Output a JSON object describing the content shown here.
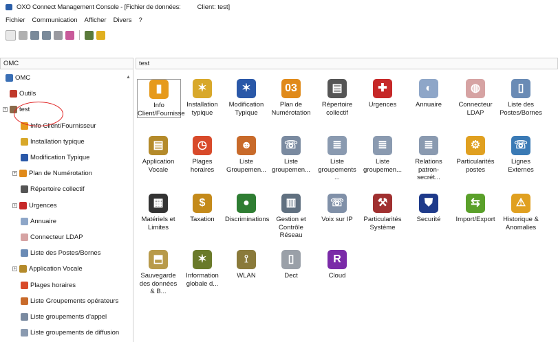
{
  "window": {
    "title": "OXO Connect Management Console - [Fichier de données:",
    "client": "Client: test]"
  },
  "menu": [
    "Fichier",
    "Communication",
    "Afficher",
    "Divers",
    "?"
  ],
  "toolbar_icons": [
    "new-icon",
    "open-icon",
    "save-icon",
    "save-as-icon",
    "print-icon",
    "connect-icon",
    "disk-icon",
    "help-icon"
  ],
  "panels": {
    "left_title": "OMC",
    "right_title": "test"
  },
  "tree": [
    {
      "label": "OMC",
      "icon": "omc-icon",
      "color": "#3a6fb5"
    },
    {
      "label": "Outils",
      "icon": "tools-icon",
      "color": "#c0392b"
    },
    {
      "label": "test",
      "icon": "folder-icon",
      "color": "#8a6a4a"
    },
    {
      "label": "Info Client/Fournisseur",
      "icon": "info-icon",
      "color": "#e69a1c"
    },
    {
      "label": "Installation typique",
      "icon": "installation-icon",
      "color": "#d8a82a"
    },
    {
      "label": "Modification Typique",
      "icon": "modification-icon",
      "color": "#2a58a8"
    },
    {
      "label": "Plan de Numérotation",
      "icon": "numbering-icon",
      "color": "#e08a1a"
    },
    {
      "label": "Répertoire collectif",
      "icon": "directory-icon",
      "color": "#555555"
    },
    {
      "label": "Urgences",
      "icon": "emergency-icon",
      "color": "#c62828"
    },
    {
      "label": "Annuaire",
      "icon": "annuaire-icon",
      "color": "#8ea6c8"
    },
    {
      "label": "Connecteur LDAP",
      "icon": "ldap-icon",
      "color": "#d6a3a3"
    },
    {
      "label": "Liste des Postes/Bornes",
      "icon": "postes-icon",
      "color": "#6a8bb5"
    },
    {
      "label": "Application Vocale",
      "icon": "voice-app-icon",
      "color": "#b48a2a"
    },
    {
      "label": "Plages horaires",
      "icon": "clock-icon",
      "color": "#d84a2a"
    },
    {
      "label": "Liste Groupements opérateurs",
      "icon": "operator-groups-icon",
      "color": "#c86a2a"
    },
    {
      "label": "Liste groupements d'appel",
      "icon": "call-groups-icon",
      "color": "#7a8aa0"
    },
    {
      "label": "Liste groupements de diffusion",
      "icon": "broadcast-groups-icon",
      "color": "#8a9ab0"
    }
  ],
  "grid": [
    {
      "label": "Info Client/Fournisse",
      "icon": "info-icon",
      "color": "#e69a1c",
      "glyph": "▮"
    },
    {
      "label": "Installation typique",
      "icon": "installation-icon",
      "color": "#d8a82a",
      "glyph": "✶"
    },
    {
      "label": "Modification Typique",
      "icon": "modification-icon",
      "color": "#2a58a8",
      "glyph": "✶"
    },
    {
      "label": "Plan de Numérotation",
      "icon": "numbering-icon",
      "color": "#e08a1a",
      "glyph": "03"
    },
    {
      "label": "Répertoire collectif",
      "icon": "directory-icon",
      "color": "#555555",
      "glyph": "▤"
    },
    {
      "label": "Urgences",
      "icon": "emergency-icon",
      "color": "#c62828",
      "glyph": "✚"
    },
    {
      "label": "Annuaire",
      "icon": "annuaire-icon",
      "color": "#8ea6c8",
      "glyph": "◐"
    },
    {
      "label": "Connecteur LDAP",
      "icon": "ldap-icon",
      "color": "#d6a3a3",
      "glyph": "◍"
    },
    {
      "label": "Liste des Postes/Bornes",
      "icon": "postes-icon",
      "color": "#6a8bb5",
      "glyph": "▯"
    },
    {
      "label": "Application Vocale",
      "icon": "voice-app-icon",
      "color": "#b48a2a",
      "glyph": "▤"
    },
    {
      "label": "Plages horaires",
      "icon": "clock-icon",
      "color": "#d84a2a",
      "glyph": "◷"
    },
    {
      "label": "Liste Groupemen...",
      "icon": "operator-groups-icon",
      "color": "#c86a2a",
      "glyph": "☻"
    },
    {
      "label": "Liste groupemen...",
      "icon": "call-groups-icon",
      "color": "#7a8aa0",
      "glyph": "☏"
    },
    {
      "label": "Liste groupements ...",
      "icon": "broadcast-groups-icon",
      "color": "#8a9ab0",
      "glyph": "≣"
    },
    {
      "label": "Liste groupemen...",
      "icon": "groups-list-icon",
      "color": "#8a9ab0",
      "glyph": "≣"
    },
    {
      "label": "Relations patron-secrét...",
      "icon": "boss-secretary-icon",
      "color": "#8a9ab0",
      "glyph": "≣"
    },
    {
      "label": "Particularités postes",
      "icon": "station-features-icon",
      "color": "#e0a020",
      "glyph": "⚙"
    },
    {
      "label": "Lignes Externes",
      "icon": "external-lines-icon",
      "color": "#3a7ab5",
      "glyph": "☏"
    },
    {
      "label": "Matériels et Limites",
      "icon": "hardware-icon",
      "color": "#333333",
      "glyph": "▦"
    },
    {
      "label": "Taxation",
      "icon": "taxation-icon",
      "color": "#c48a1a",
      "glyph": "$"
    },
    {
      "label": "Discriminations",
      "icon": "discrimination-icon",
      "color": "#2e7d32",
      "glyph": "●"
    },
    {
      "label": "Gestion et Contrôle Réseau",
      "icon": "network-icon",
      "color": "#607080",
      "glyph": "▥"
    },
    {
      "label": "Voix sur IP",
      "icon": "voip-icon",
      "color": "#8090a8",
      "glyph": "☏"
    },
    {
      "label": "Particularités Système",
      "icon": "system-features-icon",
      "color": "#a03030",
      "glyph": "⚒"
    },
    {
      "label": "Securité",
      "icon": "security-icon",
      "color": "#1e3a8a",
      "glyph": "⛊"
    },
    {
      "label": "Import/Export",
      "icon": "import-export-icon",
      "color": "#5aa02a",
      "glyph": "⇆"
    },
    {
      "label": "Historique & Anomalies",
      "icon": "history-icon",
      "color": "#e0a020",
      "glyph": "⚠"
    },
    {
      "label": "Sauvegarde des données & B...",
      "icon": "backup-icon",
      "color": "#b89a4a",
      "glyph": "⬒"
    },
    {
      "label": "Information globale d...",
      "icon": "global-info-icon",
      "color": "#6a7a2a",
      "glyph": "✶"
    },
    {
      "label": "WLAN",
      "icon": "wlan-icon",
      "color": "#8a7a3a",
      "glyph": "⟟"
    },
    {
      "label": "Dect",
      "icon": "dect-icon",
      "color": "#9aa0a8",
      "glyph": "▯"
    },
    {
      "label": "Cloud",
      "icon": "cloud-icon",
      "color": "#7a2aa8",
      "glyph": "R"
    }
  ]
}
